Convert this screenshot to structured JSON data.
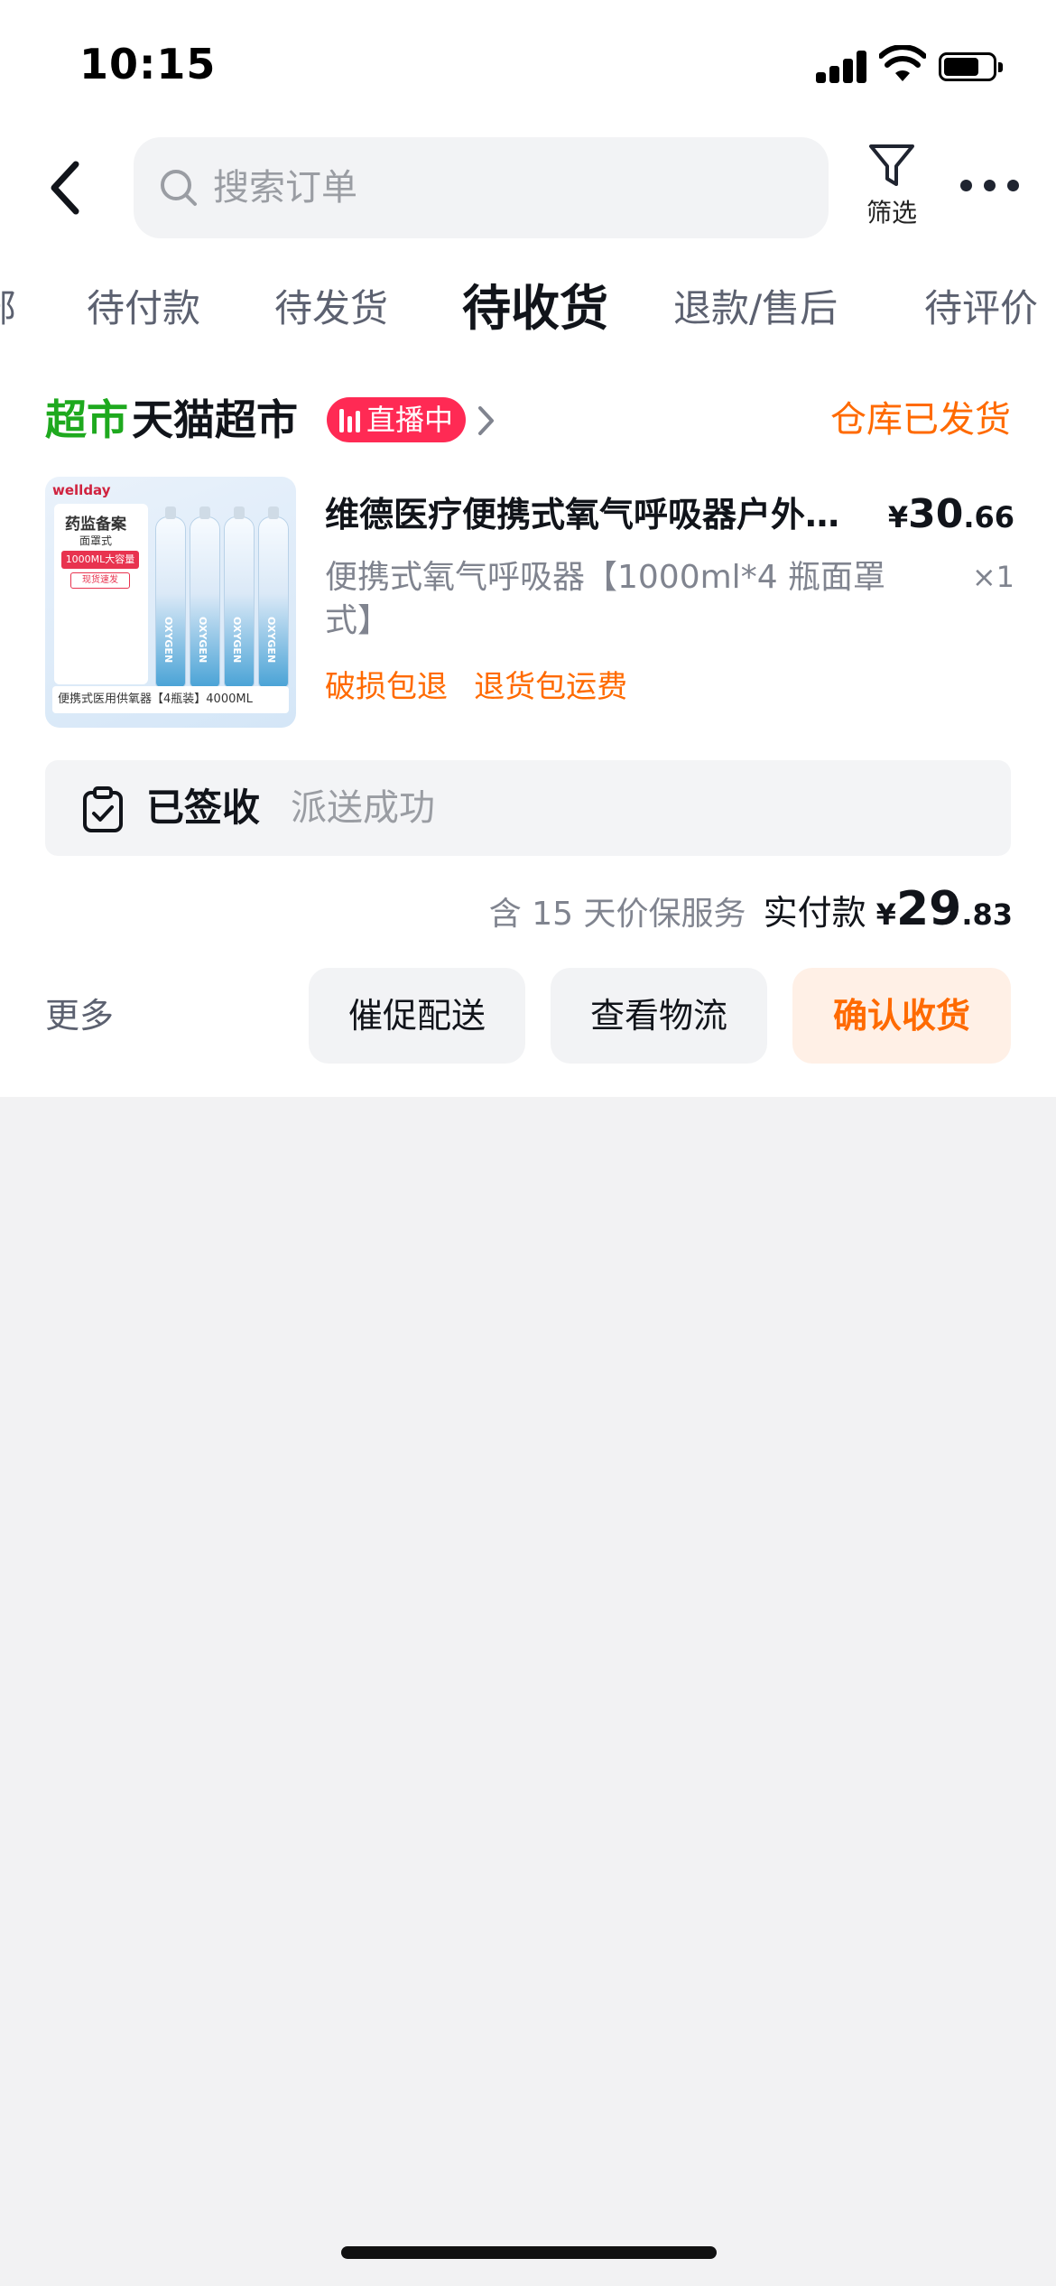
{
  "status_bar": {
    "time": "10:15"
  },
  "header": {
    "search_placeholder": "搜索订单",
    "filter_label": "筛选"
  },
  "tabs": [
    {
      "label": "待付款"
    },
    {
      "label": "待发货"
    },
    {
      "label": "待收货",
      "active": true
    },
    {
      "label": "退款/售后"
    },
    {
      "label": "待评价"
    }
  ],
  "order": {
    "store_badge": "超市",
    "store_name": "天猫超市",
    "live_label": "直播中",
    "shipping_status": "仓库已发货",
    "product": {
      "image_text": {
        "brand": "wellday",
        "title": "药监备案",
        "subtitle": "面罩式",
        "tag1": "1000ML大容量",
        "tag2": "现货速发",
        "bottle_label": "OXYGEN",
        "footer": "便携式医用供氧器【4瓶装】4000ML"
      },
      "title": "维德医疗便携式氧气呼吸器户外…",
      "price_currency": "¥",
      "price_int": "30",
      "price_dec": ".66",
      "spec": "便携式氧气呼吸器【1000ml*4 瓶面罩式】",
      "quantity": "×1",
      "service_tags": [
        "破损包退",
        "退货包运费"
      ]
    },
    "delivery": {
      "status": "已签收",
      "detail": "派送成功"
    },
    "payment": {
      "price_protect": "含 15 天价保服务",
      "paid_label": "实付款",
      "currency": "¥",
      "amount_int": "29",
      "amount_dec": ".83"
    },
    "actions": {
      "more": "更多",
      "urge": "催促配送",
      "logistics": "查看物流",
      "confirm": "确认收货"
    }
  },
  "colors": {
    "accent_orange": "#ff6a00",
    "live_red": "#ff2a54",
    "market_green": "#1ea91e"
  }
}
